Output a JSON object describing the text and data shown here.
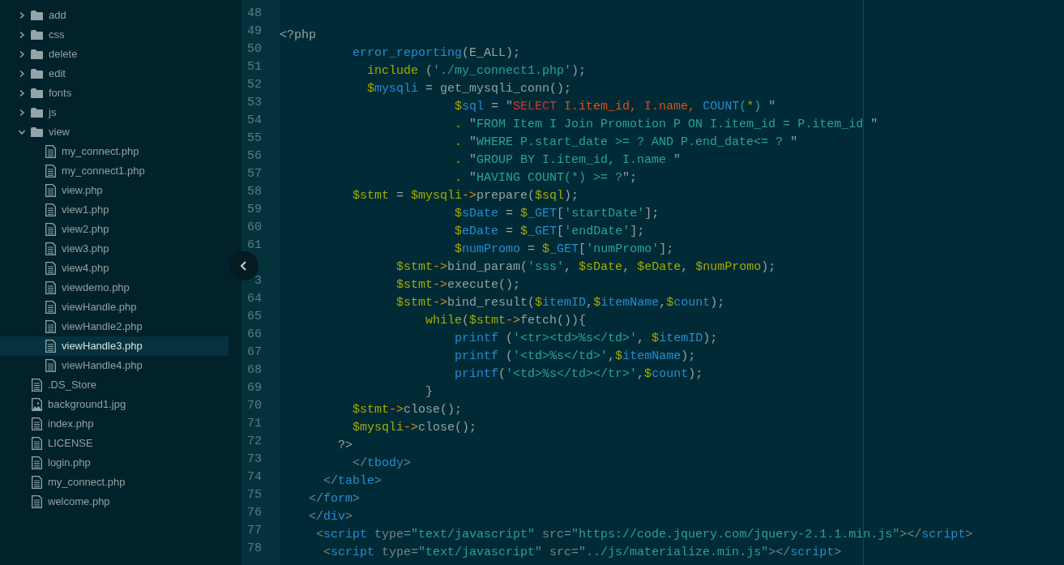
{
  "sidebar": {
    "tree": [
      {
        "label": "add",
        "kind": "folder",
        "expanded": false,
        "selected": false
      },
      {
        "label": "css",
        "kind": "folder",
        "expanded": false,
        "selected": false
      },
      {
        "label": "delete",
        "kind": "folder",
        "expanded": false,
        "selected": false
      },
      {
        "label": "edit",
        "kind": "folder",
        "expanded": false,
        "selected": false
      },
      {
        "label": "fonts",
        "kind": "folder",
        "expanded": false,
        "selected": false
      },
      {
        "label": "js",
        "kind": "folder",
        "expanded": false,
        "selected": false
      },
      {
        "label": "view",
        "kind": "folder",
        "expanded": true,
        "selected": false,
        "children": [
          {
            "label": "my_connect.php",
            "kind": "file",
            "selected": false
          },
          {
            "label": "my_connect1.php",
            "kind": "file",
            "selected": false
          },
          {
            "label": "view.php",
            "kind": "file",
            "selected": false
          },
          {
            "label": "view1.php",
            "kind": "file",
            "selected": false
          },
          {
            "label": "view2.php",
            "kind": "file",
            "selected": false
          },
          {
            "label": "view3.php",
            "kind": "file",
            "selected": false
          },
          {
            "label": "view4.php",
            "kind": "file",
            "selected": false
          },
          {
            "label": "viewdemo.php",
            "kind": "file",
            "selected": false
          },
          {
            "label": "viewHandle.php",
            "kind": "file",
            "selected": false
          },
          {
            "label": "viewHandle2.php",
            "kind": "file",
            "selected": false
          },
          {
            "label": "viewHandle3.php",
            "kind": "file",
            "selected": true
          },
          {
            "label": "viewHandle4.php",
            "kind": "file",
            "selected": false
          }
        ]
      },
      {
        "label": ".DS_Store",
        "kind": "file",
        "selected": false
      },
      {
        "label": "background1.jpg",
        "kind": "image",
        "selected": false
      },
      {
        "label": "index.php",
        "kind": "file",
        "selected": false
      },
      {
        "label": "LICENSE",
        "kind": "file",
        "selected": false
      },
      {
        "label": "login.php",
        "kind": "file",
        "selected": false
      },
      {
        "label": "my_connect.php",
        "kind": "file",
        "selected": false
      },
      {
        "label": "welcome.php",
        "kind": "file",
        "selected": false
      }
    ]
  },
  "editor": {
    "lines": [
      {
        "number": "48"
      },
      {
        "number": "49",
        "tokens": [
          {
            "kind": "plain",
            "text": "<?php"
          }
        ]
      },
      {
        "number": "50",
        "tokens": [
          {
            "kind": "function",
            "text": "          error_reporting"
          },
          {
            "kind": "plain",
            "text": "(E_ALL);"
          }
        ]
      },
      {
        "number": "51",
        "tokens": [
          {
            "kind": "variable",
            "text": "            include"
          },
          {
            "kind": "plain",
            "text": " ("
          },
          {
            "kind": "string",
            "text": "'./my_connect1.php'"
          },
          {
            "kind": "plain",
            "text": ");"
          }
        ]
      },
      {
        "number": "52",
        "tokens": [
          {
            "kind": "variable",
            "text": "            $"
          },
          {
            "kind": "function",
            "text": "mysqli"
          },
          {
            "kind": "plain",
            "text": " = get_mysqli_conn();"
          }
        ]
      },
      {
        "number": "53",
        "tokens": [
          {
            "kind": "variable",
            "text": "                        $"
          },
          {
            "kind": "function",
            "text": "sql"
          },
          {
            "kind": "plain",
            "text": " = \""
          },
          {
            "kind": "keyword",
            "text": "SELECT "
          },
          {
            "kind": "identifier",
            "text": "I.item_id, I.name, "
          },
          {
            "kind": "function",
            "text": "COUNT"
          },
          {
            "kind": "string",
            "text": "("
          },
          {
            "kind": "variable",
            "text": "*"
          },
          {
            "kind": "string",
            "text": ")"
          },
          {
            "kind": "plain",
            "text": " \""
          }
        ]
      },
      {
        "number": "54",
        "tokens": [
          {
            "kind": "variable",
            "text": "                        . "
          },
          {
            "kind": "plain",
            "text": "\""
          },
          {
            "kind": "string",
            "text": "FROM Item I Join Promotion P ON I.item_id = P.item_id "
          },
          {
            "kind": "plain",
            "text": "\""
          }
        ]
      },
      {
        "number": "55",
        "tokens": [
          {
            "kind": "variable",
            "text": "                        . "
          },
          {
            "kind": "plain",
            "text": "\""
          },
          {
            "kind": "string",
            "text": "WHERE P.start_date >= ? AND P.end_date<= ? "
          },
          {
            "kind": "plain",
            "text": "\""
          }
        ]
      },
      {
        "number": "56",
        "tokens": [
          {
            "kind": "variable",
            "text": "                        . "
          },
          {
            "kind": "plain",
            "text": "\""
          },
          {
            "kind": "string",
            "text": "GROUP BY I.item_id, I.name "
          },
          {
            "kind": "plain",
            "text": "\""
          }
        ]
      },
      {
        "number": "57",
        "tokens": [
          {
            "kind": "variable",
            "text": "                        . "
          },
          {
            "kind": "plain",
            "text": "\""
          },
          {
            "kind": "string",
            "text": "HAVING COUNT(*) >= ?"
          },
          {
            "kind": "plain",
            "text": "\";"
          }
        ]
      },
      {
        "number": "58",
        "tokens": [
          {
            "kind": "variable",
            "text": "          $stmt"
          },
          {
            "kind": "plain",
            "text": " = "
          },
          {
            "kind": "variable",
            "text": "$mysqli"
          },
          {
            "kind": "arrow",
            "text": "->"
          },
          {
            "kind": "plain",
            "text": "prepare("
          },
          {
            "kind": "variable",
            "text": "$sql"
          },
          {
            "kind": "plain",
            "text": ");"
          }
        ]
      },
      {
        "number": "59",
        "tokens": [
          {
            "kind": "variable",
            "text": "                        $"
          },
          {
            "kind": "function",
            "text": "sDate"
          },
          {
            "kind": "plain",
            "text": " = "
          },
          {
            "kind": "variable",
            "text": "$"
          },
          {
            "kind": "function",
            "text": "_GET"
          },
          {
            "kind": "plain",
            "text": "["
          },
          {
            "kind": "string",
            "text": "'startDate'"
          },
          {
            "kind": "plain",
            "text": "];"
          }
        ]
      },
      {
        "number": "60",
        "tokens": [
          {
            "kind": "variable",
            "text": "                        $"
          },
          {
            "kind": "function",
            "text": "eDate"
          },
          {
            "kind": "plain",
            "text": " = "
          },
          {
            "kind": "variable",
            "text": "$"
          },
          {
            "kind": "function",
            "text": "_GET"
          },
          {
            "kind": "plain",
            "text": "["
          },
          {
            "kind": "string",
            "text": "'endDate'"
          },
          {
            "kind": "plain",
            "text": "];"
          }
        ]
      },
      {
        "number": "61",
        "tokens": [
          {
            "kind": "variable",
            "text": "                        $"
          },
          {
            "kind": "function",
            "text": "numPromo"
          },
          {
            "kind": "plain",
            "text": " = "
          },
          {
            "kind": "variable",
            "text": "$"
          },
          {
            "kind": "function",
            "text": "_GET"
          },
          {
            "kind": "plain",
            "text": "["
          },
          {
            "kind": "string",
            "text": "'numPromo'"
          },
          {
            "kind": "plain",
            "text": "];"
          }
        ]
      },
      {
        "tokens": [
          {
            "kind": "variable",
            "text": "                $stmt"
          },
          {
            "kind": "arrow",
            "text": "->"
          },
          {
            "kind": "plain",
            "text": "bind_param("
          },
          {
            "kind": "string",
            "text": "'sss'"
          },
          {
            "kind": "plain",
            "text": ", "
          },
          {
            "kind": "variable",
            "text": "$sDate"
          },
          {
            "kind": "plain",
            "text": ", "
          },
          {
            "kind": "variable",
            "text": "$eDate"
          },
          {
            "kind": "plain",
            "text": ", "
          },
          {
            "kind": "variable",
            "text": "$numPromo"
          },
          {
            "kind": "plain",
            "text": ");"
          }
        ]
      },
      {
        "number": "3",
        "tokens": [
          {
            "kind": "variable",
            "text": "                $stmt"
          },
          {
            "kind": "arrow",
            "text": "->"
          },
          {
            "kind": "plain",
            "text": "execute();"
          }
        ]
      },
      {
        "number": "64",
        "tokens": [
          {
            "kind": "variable",
            "text": "                $stmt"
          },
          {
            "kind": "arrow",
            "text": "->"
          },
          {
            "kind": "plain",
            "text": "bind_result("
          },
          {
            "kind": "variable",
            "text": "$"
          },
          {
            "kind": "function",
            "text": "itemID"
          },
          {
            "kind": "plain",
            "text": ","
          },
          {
            "kind": "variable",
            "text": "$"
          },
          {
            "kind": "function",
            "text": "itemName"
          },
          {
            "kind": "plain",
            "text": ","
          },
          {
            "kind": "variable",
            "text": "$"
          },
          {
            "kind": "function",
            "text": "count"
          },
          {
            "kind": "plain",
            "text": ");"
          }
        ]
      },
      {
        "number": "65",
        "tokens": [
          {
            "kind": "variable",
            "text": "                    while"
          },
          {
            "kind": "plain",
            "text": "("
          },
          {
            "kind": "variable",
            "text": "$stmt"
          },
          {
            "kind": "arrow",
            "text": "->"
          },
          {
            "kind": "plain",
            "text": "fetch()){"
          }
        ]
      },
      {
        "number": "66",
        "tokens": [
          {
            "kind": "function",
            "text": "                        printf"
          },
          {
            "kind": "plain",
            "text": " ("
          },
          {
            "kind": "string",
            "text": "'<tr><td>%s</td>'"
          },
          {
            "kind": "plain",
            "text": ", "
          },
          {
            "kind": "variable",
            "text": "$"
          },
          {
            "kind": "function",
            "text": "itemID"
          },
          {
            "kind": "plain",
            "text": ");"
          }
        ]
      },
      {
        "number": "67",
        "tokens": [
          {
            "kind": "function",
            "text": "                        printf"
          },
          {
            "kind": "plain",
            "text": " ("
          },
          {
            "kind": "string",
            "text": "'<td>%s</td>'"
          },
          {
            "kind": "plain",
            "text": ","
          },
          {
            "kind": "variable",
            "text": "$"
          },
          {
            "kind": "function",
            "text": "itemName"
          },
          {
            "kind": "plain",
            "text": ");"
          }
        ]
      },
      {
        "number": "68",
        "tokens": [
          {
            "kind": "function",
            "text": "                        printf"
          },
          {
            "kind": "plain",
            "text": "("
          },
          {
            "kind": "string",
            "text": "'<td>%s</td></tr>'"
          },
          {
            "kind": "plain",
            "text": ","
          },
          {
            "kind": "variable",
            "text": "$"
          },
          {
            "kind": "function",
            "text": "count"
          },
          {
            "kind": "plain",
            "text": ");"
          }
        ]
      },
      {
        "number": "69",
        "tokens": [
          {
            "kind": "plain",
            "text": "                    }"
          }
        ]
      },
      {
        "number": "70",
        "tokens": [
          {
            "kind": "variable",
            "text": "          $stmt"
          },
          {
            "kind": "arrow",
            "text": "->"
          },
          {
            "kind": "plain",
            "text": "close();"
          }
        ]
      },
      {
        "number": "71",
        "tokens": [
          {
            "kind": "variable",
            "text": "          $mysqli"
          },
          {
            "kind": "arrow",
            "text": "->"
          },
          {
            "kind": "plain",
            "text": "close();"
          }
        ]
      },
      {
        "number": "72",
        "tokens": [
          {
            "kind": "plain",
            "text": "        ?>"
          }
        ]
      },
      {
        "number": "73",
        "tokens": [
          {
            "kind": "punctuation",
            "text": "          </"
          },
          {
            "kind": "function",
            "text": "tbody"
          },
          {
            "kind": "punctuation",
            "text": ">"
          }
        ]
      },
      {
        "number": "74",
        "tokens": [
          {
            "kind": "punctuation",
            "text": "      </"
          },
          {
            "kind": "function",
            "text": "table"
          },
          {
            "kind": "punctuation",
            "text": ">"
          }
        ]
      },
      {
        "number": "75",
        "tokens": [
          {
            "kind": "punctuation",
            "text": "    </"
          },
          {
            "kind": "function",
            "text": "form"
          },
          {
            "kind": "punctuation",
            "text": ">"
          }
        ]
      },
      {
        "number": "76",
        "tokens": [
          {
            "kind": "punctuation",
            "text": "    </"
          },
          {
            "kind": "function",
            "text": "div"
          },
          {
            "kind": "punctuation",
            "text": ">"
          }
        ]
      },
      {
        "number": "77",
        "tokens": [
          {
            "kind": "punctuation",
            "text": "     <"
          },
          {
            "kind": "function",
            "text": "script"
          },
          {
            "kind": "punctuation",
            "text": " type="
          },
          {
            "kind": "string",
            "text": "\"text/javascript\""
          },
          {
            "kind": "punctuation",
            "text": " src="
          },
          {
            "kind": "string",
            "text": "\"https://code.jquery.com/jquery-2.1.1.min.js\""
          },
          {
            "kind": "punctuation",
            "text": "></"
          },
          {
            "kind": "function",
            "text": "script"
          },
          {
            "kind": "punctuation",
            "text": ">"
          }
        ]
      },
      {
        "number": "78",
        "tokens": [
          {
            "kind": "punctuation",
            "text": "      <"
          },
          {
            "kind": "function",
            "text": "script"
          },
          {
            "kind": "punctuation",
            "text": " type="
          },
          {
            "kind": "string",
            "text": "\"text/javascript\""
          },
          {
            "kind": "punctuation",
            "text": " src="
          },
          {
            "kind": "string",
            "text": "\"../js/materialize.min.js\""
          },
          {
            "kind": "punctuation",
            "text": "></"
          },
          {
            "kind": "function",
            "text": "script"
          },
          {
            "kind": "punctuation",
            "text": ">"
          }
        ]
      }
    ]
  }
}
